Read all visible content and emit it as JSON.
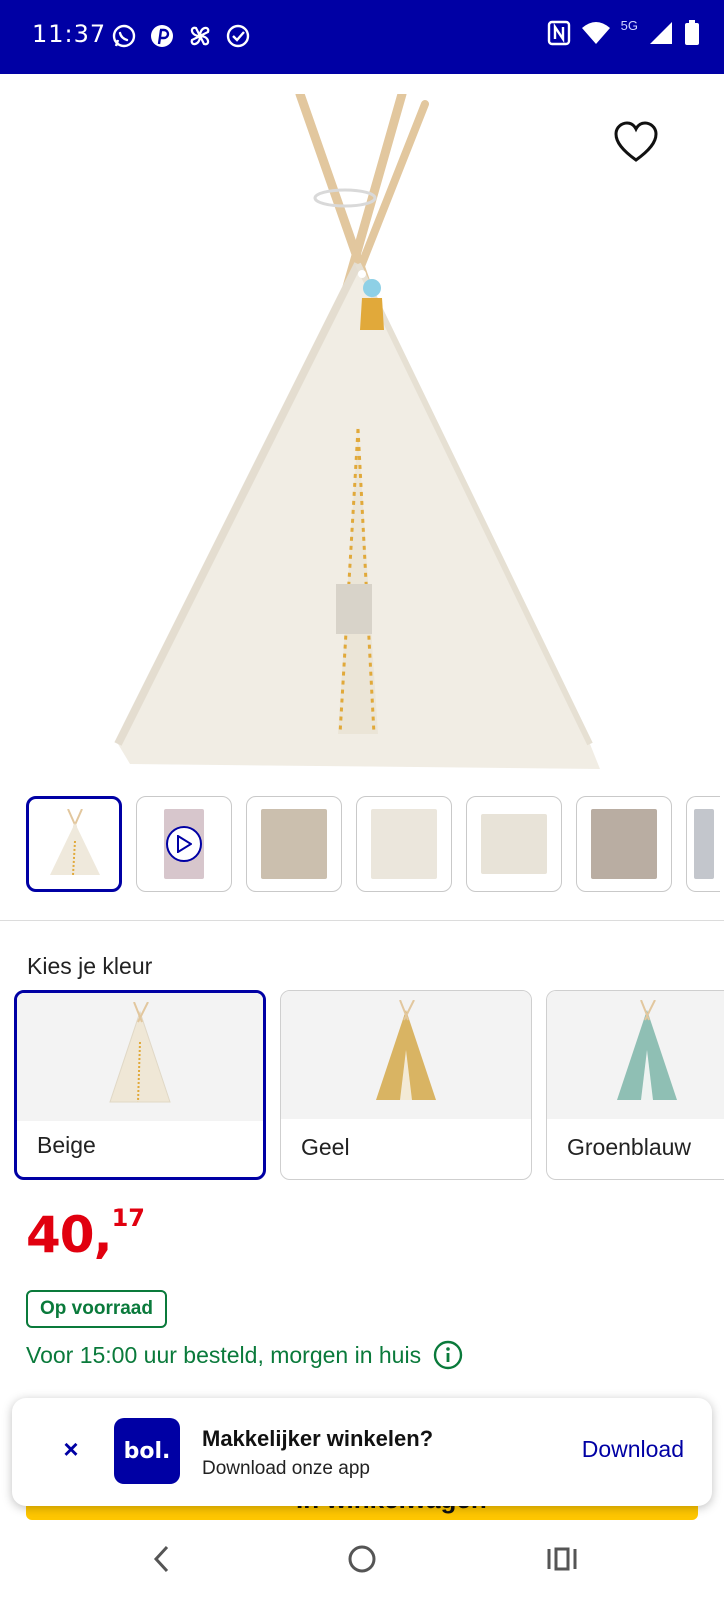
{
  "status_bar": {
    "time": "11:37",
    "network": "5G",
    "background_color": "#0000a4",
    "left_icons": [
      "whatsapp-icon",
      "pinterest-icon",
      "pinwheel-icon",
      "check-circle-icon"
    ],
    "right_icons": [
      "nfc-icon",
      "wifi-icon",
      "signal-icon",
      "battery-icon"
    ]
  },
  "product": {
    "gallery_icons": [
      "heart-icon"
    ],
    "thumbnails": [
      {
        "type": "image",
        "selected": true
      },
      {
        "type": "video",
        "selected": false
      },
      {
        "type": "image",
        "selected": false
      },
      {
        "type": "image",
        "selected": false
      },
      {
        "type": "image",
        "selected": false
      },
      {
        "type": "image",
        "selected": false
      },
      {
        "type": "image",
        "selected": false
      }
    ],
    "color_section_title": "Kies je kleur",
    "colors": [
      {
        "label": "Beige",
        "selected": true,
        "swatch": "#efe7d6"
      },
      {
        "label": "Geel",
        "selected": false,
        "swatch": "#d9b463"
      },
      {
        "label": "Groenblauw",
        "selected": false,
        "swatch": "#8fbfb4"
      }
    ],
    "price_int": "40,",
    "price_frac": "17",
    "stock_badge": "Op voorraad",
    "delivery_text": "Voor 15:00 uur besteld, morgen in huis"
  },
  "cart_button_label": "In winkelwagen",
  "app_banner": {
    "logo_text": "bol.",
    "title": "Makkelijker winkelen?",
    "subtitle": "Download onze app",
    "action": "Download",
    "close": "×"
  },
  "nav": {
    "icons": [
      "back-icon",
      "home-icon",
      "recents-icon"
    ]
  },
  "colors": {
    "brand_blue": "#0000a4",
    "price_red": "#e1000f",
    "stock_green": "#0a7a3b",
    "cart_yellow": "#ffc700"
  }
}
